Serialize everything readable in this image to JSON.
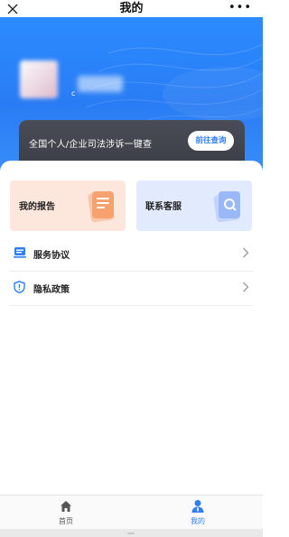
{
  "header": {
    "title": "我的",
    "close_icon": "close-icon",
    "more_label": "•••"
  },
  "profile": {
    "avatar_icon": "avatar-blurred",
    "name_partial": "c"
  },
  "banner": {
    "text": "全国个人/企业司法涉诉一键查",
    "button_label": "前往查询"
  },
  "cards": {
    "report_label": "我的报告",
    "service_label": "联系客服"
  },
  "menu": {
    "items": [
      {
        "label": "服务协议",
        "icon": "document-icon"
      },
      {
        "label": "隐私政策",
        "icon": "shield-icon"
      }
    ]
  },
  "tabbar": {
    "items": [
      {
        "label": "首页",
        "icon": "home-icon",
        "active": false
      },
      {
        "label": "我的",
        "icon": "user-icon",
        "active": true
      }
    ]
  },
  "colors": {
    "primary": "#2f7ff2",
    "hero_top": "#2b8bff",
    "banner_bg": "#3f414b",
    "report_bg": "#fde7dc",
    "service_bg": "#e2ebfd",
    "tab_inactive": "#555555"
  }
}
